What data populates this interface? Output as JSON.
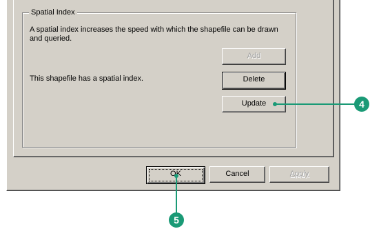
{
  "spatial_index": {
    "title": "Spatial Index",
    "description": "A spatial index increases the speed with which the shapefile can be drawn and queried.",
    "status": "This shapefile has a spatial index.",
    "add_label": "Add",
    "delete_label": "Delete",
    "update_label": "Update"
  },
  "footer": {
    "ok_label": "OK",
    "cancel_label": "Cancel",
    "apply_label": "Apply"
  },
  "callouts": {
    "step_update": "4",
    "step_ok": "5",
    "color": "#1a9a76"
  }
}
